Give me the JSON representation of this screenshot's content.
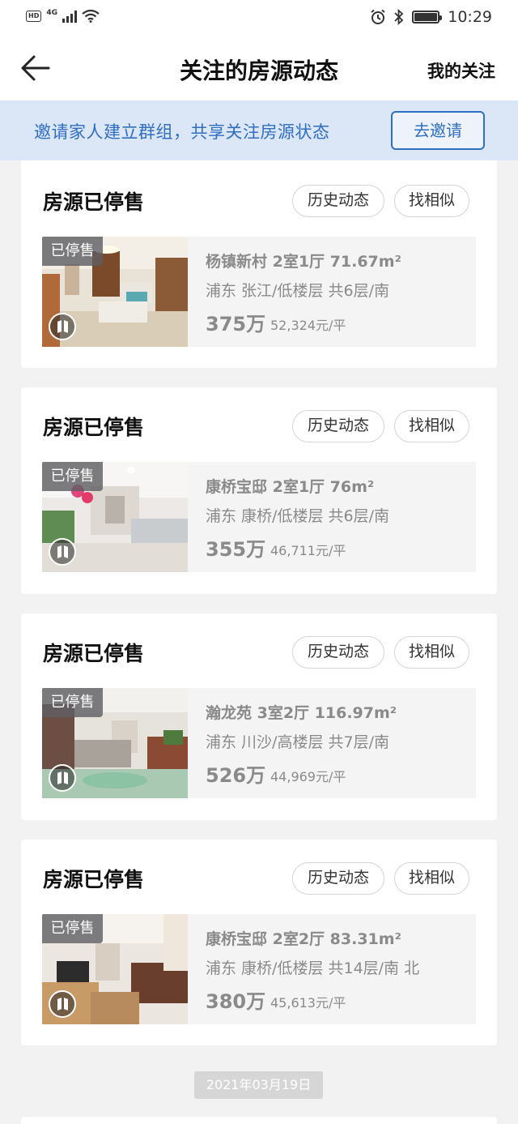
{
  "status_bar": {
    "time": "10:29",
    "network": "4G",
    "hd": "HD"
  },
  "nav": {
    "title": "关注的房源动态",
    "right_link": "我的关注"
  },
  "banner": {
    "text": "邀请家人建立群组，共享关注房源状态",
    "button": "去邀请"
  },
  "cards": [
    {
      "status": "房源已停售",
      "history_btn": "历史动态",
      "similar_btn": "找相似",
      "badge": "已停售",
      "title": "杨镇新村 2室1厅 71.67m²",
      "location": "浦东 张江/低楼层 共6层/南",
      "price": "375万",
      "unit_price": "52,324元/平"
    },
    {
      "status": "房源已停售",
      "history_btn": "历史动态",
      "similar_btn": "找相似",
      "badge": "已停售",
      "title": "康桥宝邸 2室1厅 76m²",
      "location": "浦东 康桥/低楼层 共6层/南",
      "price": "355万",
      "unit_price": "46,711元/平"
    },
    {
      "status": "房源已停售",
      "history_btn": "历史动态",
      "similar_btn": "找相似",
      "badge": "已停售",
      "title": "瀚龙苑 3室2厅 116.97m²",
      "location": "浦东 川沙/高楼层 共7层/南",
      "price": "526万",
      "unit_price": "44,969元/平"
    },
    {
      "status": "房源已停售",
      "history_btn": "历史动态",
      "similar_btn": "找相似",
      "badge": "已停售",
      "title": "康桥宝邸 2室2厅 83.31m²",
      "location": "浦东 康桥/低楼层 共14层/南 北",
      "price": "380万",
      "unit_price": "45,613元/平"
    }
  ],
  "date_divider": "2021年03月19日"
}
